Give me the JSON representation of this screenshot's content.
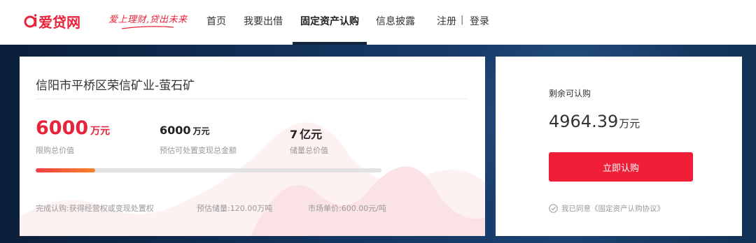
{
  "header": {
    "logo_text": "爱贷网",
    "slogan": "爱上理财,贷出未来",
    "nav": [
      {
        "label": "首页",
        "active": false
      },
      {
        "label": "我要出借",
        "active": false
      },
      {
        "label": "固定资产认购",
        "active": true
      },
      {
        "label": "信息披露",
        "active": false
      }
    ],
    "register_label": "注册",
    "separator": "|",
    "login_label": "登录"
  },
  "project": {
    "title": "信阳市平桥区荣信矿业-萤石矿",
    "limit_value": {
      "number": "6000",
      "unit": "万元",
      "label": "限购总价值"
    },
    "estimated_value": {
      "number": "6000",
      "unit": "万元",
      "label": "预估可处置变现总金额"
    },
    "reserve_value": {
      "number": "7",
      "unit": "亿元",
      "label": "储量总价值"
    },
    "progress_fraction": 0.1726,
    "meta": {
      "completion": "完成认购:获得经营权或变现处置权",
      "reserve": "预估储量:120.00万吨",
      "unit_price": "市场单价:600.00元/吨"
    }
  },
  "subscribe": {
    "remaining_label": "剩余可认购",
    "remaining_number": "4964.39",
    "remaining_unit": "万元",
    "button_label": "立即认购",
    "agreement_text": "我已同意《固定资产认购协议》"
  },
  "colors": {
    "brand_red": "#e8243c",
    "button_red": "#f01e36",
    "banner_navy": "#14345f",
    "progress_start": "#ee3e44",
    "progress_end": "#f6842c"
  },
  "icons": {
    "logo": "ai-logo-icon",
    "agree": "check-circle-icon"
  }
}
